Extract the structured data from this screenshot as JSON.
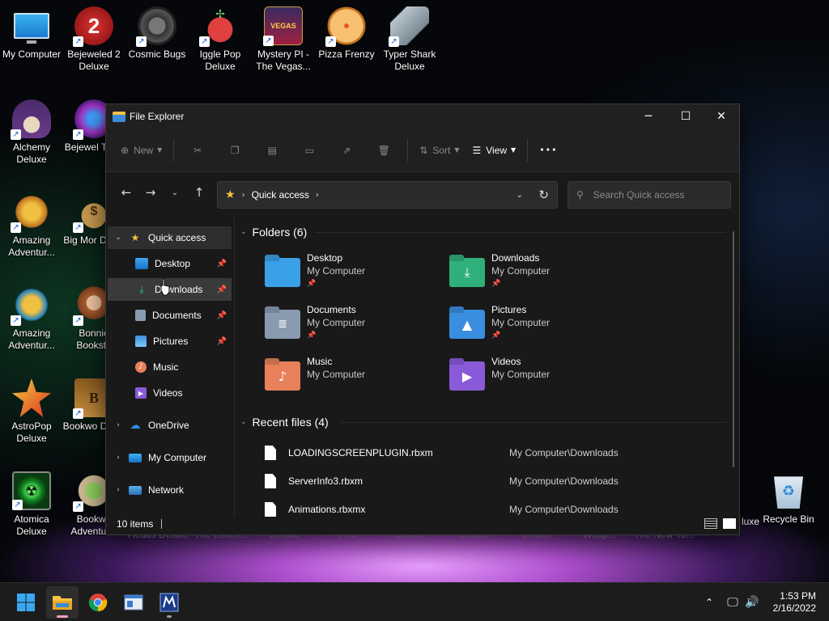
{
  "desktop": {
    "icons": [
      {
        "label": "My Computer",
        "icon": "monitor-icon"
      },
      {
        "label": "Bejeweled 2 Deluxe",
        "icon": "bejeweled-2-icon"
      },
      {
        "label": "Cosmic Bugs",
        "icon": "cosmic-bugs-icon"
      },
      {
        "label": "Iggle Pop Deluxe",
        "icon": "iggle-pop-icon"
      },
      {
        "label": "Mystery PI - The Vegas...",
        "icon": "mystery-pi-icon"
      },
      {
        "label": "Pizza Frenzy",
        "icon": "pizza-icon"
      },
      {
        "label": "Typer Shark Deluxe",
        "icon": "shark-icon"
      },
      {
        "label": "Alchemy Deluxe",
        "icon": "wizard-icon"
      },
      {
        "label": "Bejewel Twist",
        "icon": "bejeweled-twist-icon"
      },
      {
        "label": "Amazing Adventur...",
        "icon": "amazing-adventures-icon"
      },
      {
        "label": "Big Mor Delux",
        "icon": "money-bag-icon"
      },
      {
        "label": "Amazing Adventur...",
        "icon": "amazing-adventures-2-icon"
      },
      {
        "label": "Bonnie Booksto",
        "icon": "bonnie-icon"
      },
      {
        "label": "AstroPop Deluxe",
        "icon": "astropop-icon"
      },
      {
        "label": "Bookwo Delux",
        "icon": "bookworm-icon"
      },
      {
        "label": "Atomica Deluxe",
        "icon": "atomica-icon"
      },
      {
        "label": "Bookwo Adventur...",
        "icon": "bookworm-adventures-icon"
      },
      {
        "label": "Recycle Bin",
        "icon": "recycle-bin-icon"
      }
    ],
    "hidden_labels": [
      "Heads Deluxe",
      "The Lotteri...",
      "Deluxe",
      "Pow",
      "Deluxe",
      "Deluxe",
      "Deluxe",
      "Weap...",
      "The New Yo...",
      "luxe"
    ]
  },
  "explorer": {
    "title": "File Explorer",
    "window_controls": {
      "minimize": "─",
      "maximize": "☐",
      "close": "✕"
    },
    "toolbar": {
      "new": "New",
      "sort": "Sort",
      "view": "View",
      "more": "•••"
    },
    "address": {
      "crumb": "Quick access"
    },
    "search": {
      "placeholder": "Search Quick access"
    },
    "sidebar": [
      {
        "label": "Quick access",
        "pinned": false
      },
      {
        "label": "Desktop",
        "pinned": true
      },
      {
        "label": "Downloads",
        "pinned": true
      },
      {
        "label": "Documents",
        "pinned": true
      },
      {
        "label": "Pictures",
        "pinned": true
      },
      {
        "label": "Music",
        "pinned": false
      },
      {
        "label": "Videos",
        "pinned": false
      },
      {
        "label": "OneDrive",
        "pinned": false
      },
      {
        "label": "My Computer",
        "pinned": false
      },
      {
        "label": "Network",
        "pinned": false
      }
    ],
    "folders_header": "Folders (6)",
    "folders": [
      {
        "name": "Desktop",
        "location": "My Computer",
        "pinned": true,
        "color": "#3aa0e8"
      },
      {
        "name": "Downloads",
        "location": "My Computer",
        "pinned": true,
        "color": "#2fb07a"
      },
      {
        "name": "Documents",
        "location": "My Computer",
        "pinned": true,
        "color": "#8a9bb0"
      },
      {
        "name": "Pictures",
        "location": "My Computer",
        "pinned": true,
        "color": "#3a8ee0"
      },
      {
        "name": "Music",
        "location": "My Computer",
        "pinned": false,
        "color": "#e8805a"
      },
      {
        "name": "Videos",
        "location": "My Computer",
        "pinned": false,
        "color": "#8a5ad8"
      }
    ],
    "recent_header": "Recent files (4)",
    "recent_files": [
      {
        "name": "LOADINGSCREENPLUGIN.rbxm",
        "path": "My Computer\\Downloads"
      },
      {
        "name": "ServerInfo3.rbxm",
        "path": "My Computer\\Downloads"
      },
      {
        "name": "Animations.rbxmx",
        "path": "My Computer\\Downloads"
      }
    ],
    "status": {
      "items": "10 items"
    }
  },
  "taskbar": {
    "clock_time": "1:53 PM",
    "clock_date": "2/16/2022",
    "tray_chevron": "^"
  },
  "colors": {
    "accent_yellow": "#f5c342",
    "window_bg": "#191919"
  }
}
